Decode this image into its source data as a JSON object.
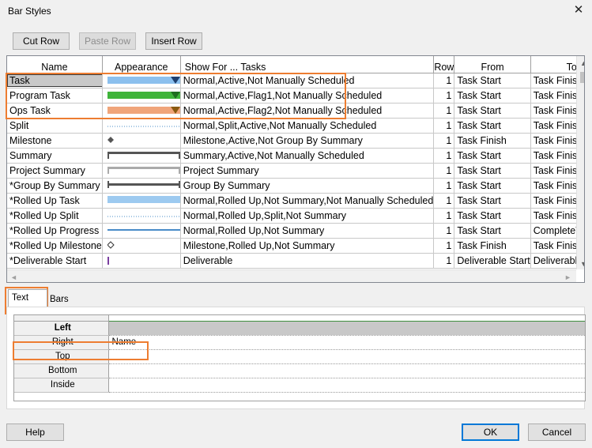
{
  "window": {
    "title": "Bar Styles",
    "close_glyph": "✕"
  },
  "toolbar": {
    "cut_row": "Cut Row",
    "paste_row": "Paste Row",
    "insert_row": "Insert Row"
  },
  "columns": [
    "Name",
    "Appearance",
    "Show For ... Tasks",
    "Row",
    "From",
    "To"
  ],
  "rows": [
    {
      "name": "Task",
      "appearance": "task-bar",
      "show_for": "Normal,Active,Not Manually Scheduled",
      "row": "1",
      "from": "Task Start",
      "to": "Task Finish"
    },
    {
      "name": "Program Task",
      "appearance": "program-task-bar",
      "show_for": "Normal,Active,Flag1,Not Manually Scheduled",
      "row": "1",
      "from": "Task Start",
      "to": "Task Finish"
    },
    {
      "name": "Ops Task",
      "appearance": "ops-task-bar",
      "show_for": "Normal,Active,Flag2,Not Manually Scheduled",
      "row": "1",
      "from": "Task Start",
      "to": "Task Finish"
    },
    {
      "name": "Split",
      "appearance": "split-dotted-line",
      "show_for": "Normal,Split,Active,Not Manually Scheduled",
      "row": "1",
      "from": "Task Start",
      "to": "Task Finish"
    },
    {
      "name": "Milestone",
      "appearance": "milestone-diamond",
      "show_for": "Milestone,Active,Not Group By Summary",
      "row": "1",
      "from": "Task Finish",
      "to": "Task Finish"
    },
    {
      "name": "Summary",
      "appearance": "summary-bracket",
      "show_for": "Summary,Active,Not Manually Scheduled",
      "row": "1",
      "from": "Task Start",
      "to": "Task Finish"
    },
    {
      "name": "Project Summary",
      "appearance": "project-summary-bracket",
      "show_for": "Project Summary",
      "row": "1",
      "from": "Task Start",
      "to": "Task Finish"
    },
    {
      "name": "*Group By Summary",
      "appearance": "group-summary-bar",
      "show_for": "Group By Summary",
      "row": "1",
      "from": "Task Start",
      "to": "Task Finish"
    },
    {
      "name": "*Rolled Up Task",
      "appearance": "rolled-up-task-bar",
      "show_for": "Normal,Rolled Up,Not Summary,Not Manually Scheduled",
      "row": "1",
      "from": "Task Start",
      "to": "Task Finish"
    },
    {
      "name": "*Rolled Up Split",
      "appearance": "rolled-up-split-line",
      "show_for": "Normal,Rolled Up,Split,Not Summary",
      "row": "1",
      "from": "Task Start",
      "to": "Task Finish"
    },
    {
      "name": "*Rolled Up Progress",
      "appearance": "rolled-up-progress-line",
      "show_for": "Normal,Rolled Up,Not Summary",
      "row": "1",
      "from": "Task Start",
      "to": "CompleteThrough"
    },
    {
      "name": "*Rolled Up Milestone",
      "appearance": "rolled-up-milestone-diamond",
      "show_for": "Milestone,Rolled Up,Not Summary",
      "row": "1",
      "from": "Task Finish",
      "to": "Task Finish"
    },
    {
      "name": "*Deliverable Start",
      "appearance": "deliverable-start-tick",
      "show_for": "Deliverable",
      "row": "1",
      "from": "Deliverable Start",
      "to": "Deliverable Start"
    }
  ],
  "tabs": {
    "text": "Text",
    "bars": "Bars"
  },
  "text_grid": [
    {
      "label": "Left",
      "value": ""
    },
    {
      "label": "Right",
      "value": "Name"
    },
    {
      "label": "Top",
      "value": ""
    },
    {
      "label": "Bottom",
      "value": ""
    },
    {
      "label": "Inside",
      "value": ""
    }
  ],
  "buttons": {
    "help": "Help",
    "ok": "OK",
    "cancel": "Cancel"
  },
  "colors": {
    "task_bar": "#8cc0ee",
    "task_marker": "#1f3f6e",
    "program_bar": "#3fb43a",
    "program_marker": "#1e6e1e",
    "ops_bar": "#f0a57a",
    "ops_marker": "#8a5a10",
    "highlight": "#ed7d31",
    "rolled_up_bar": "#9dcaf0",
    "rolled_up_line": "#4a8cc8"
  }
}
